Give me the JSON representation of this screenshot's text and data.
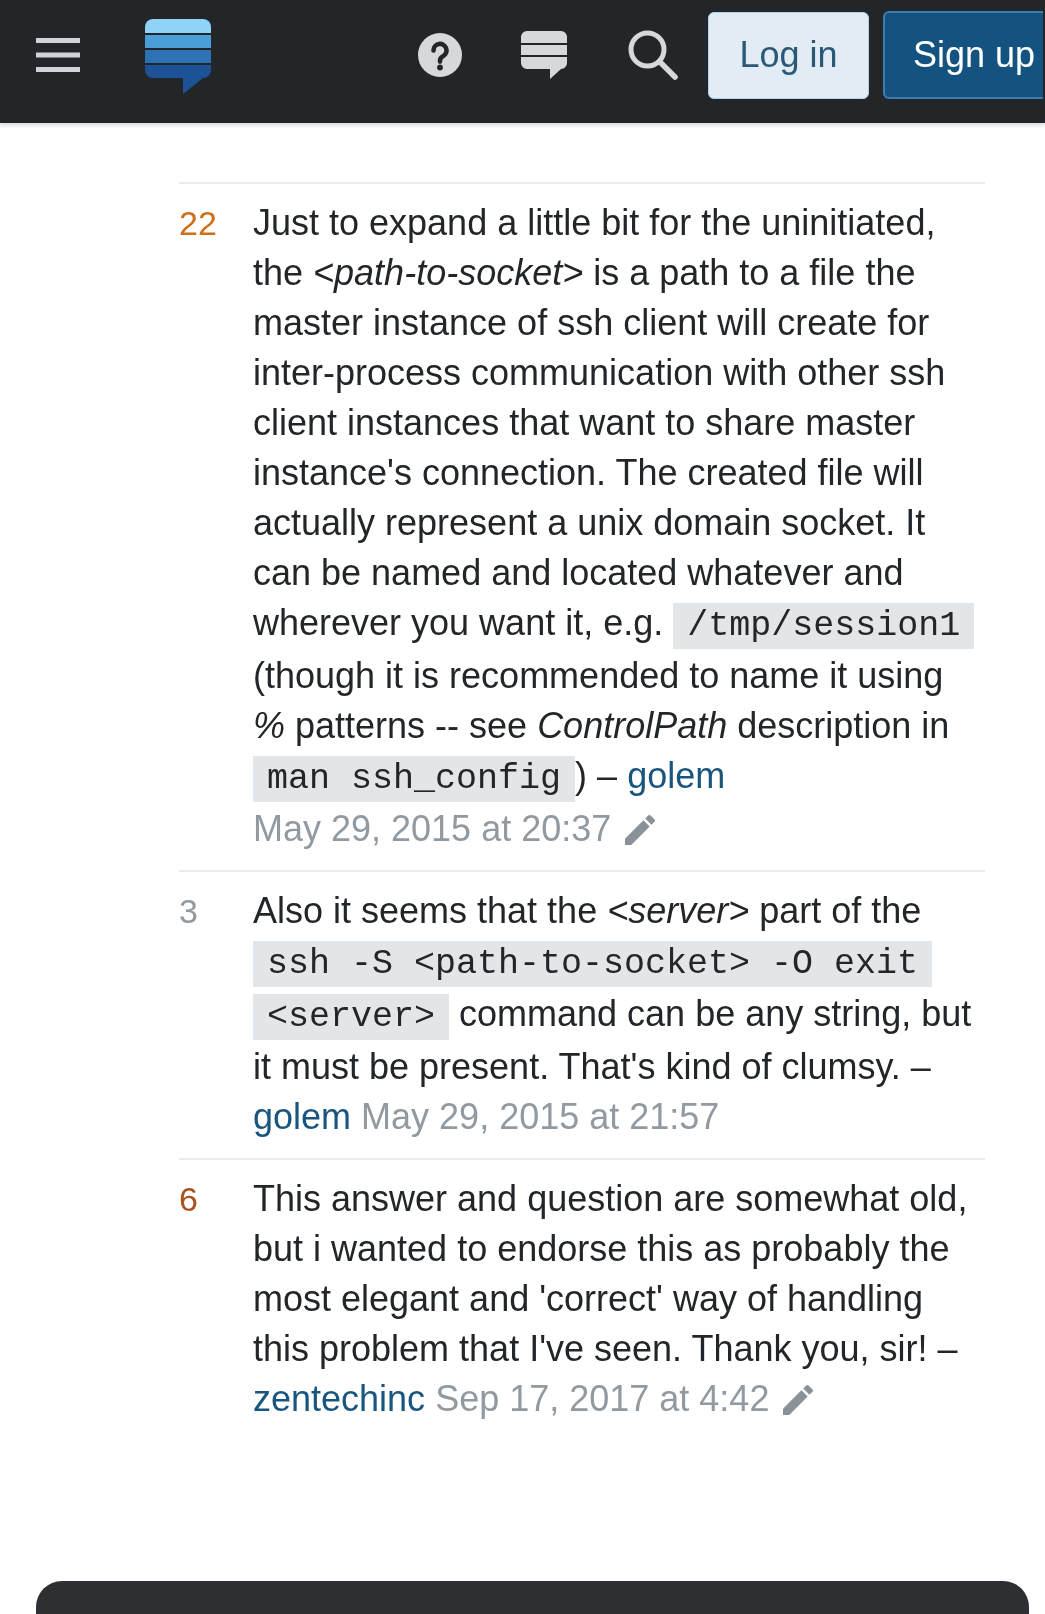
{
  "header": {
    "buttons": [
      {
        "label": "Log in",
        "kind": "secondary"
      },
      {
        "label": "Sign up",
        "kind": "primary"
      }
    ]
  },
  "comments": [
    {
      "score": {
        "text": "22",
        "color": "#cf6f18"
      },
      "body": [
        {
          "kind": "text",
          "text": "Just to expand a little bit for the uninitiated, the *<path-to-socket>* is a path to a file the master instance of ssh client will create for inter-process communication with other ssh client instances that want to share master instance's connection. The created file will actually represent a unix domain socket. It can be named and located whatever and wherever you want it, e.g. "
        },
        {
          "kind": "code",
          "text": "/tmp/session1"
        },
        {
          "kind": "text",
          "text": " (though it is recommended to name it using *%* patterns -- see *ControlPath* description in "
        },
        {
          "kind": "code",
          "text": "man ssh_config"
        },
        {
          "kind": "text",
          "text": ")"
        }
      ],
      "separator": "–",
      "user": "golem",
      "date": "May 29, 2015 at 20:37",
      "edited": true
    },
    {
      "score": {
        "text": "3",
        "color": "#9199a1"
      },
      "body": [
        {
          "kind": "text",
          "text": "Also it seems that the *<server>* part of the "
        },
        {
          "kind": "code",
          "text": "ssh -S <path-to-socket> -O exit <server>"
        },
        {
          "kind": "text",
          "text": " command can be any string, but it must be present. That's kind of clumsy."
        }
      ],
      "separator": "–",
      "user": "golem",
      "date": "May 29, 2015 at 21:57",
      "edited": false
    },
    {
      "score": {
        "text": "6",
        "color": "#a8541c"
      },
      "body": [
        {
          "kind": "text",
          "text": "This answer and question are somewhat old, but i wanted to endorse this as probably the most elegant and 'correct' way of handling this problem that I've seen. Thank you, sir!"
        }
      ],
      "separator": "–",
      "user": "zentechinc",
      "date": "Sep 17, 2017 at 4:42",
      "edited": true
    }
  ]
}
